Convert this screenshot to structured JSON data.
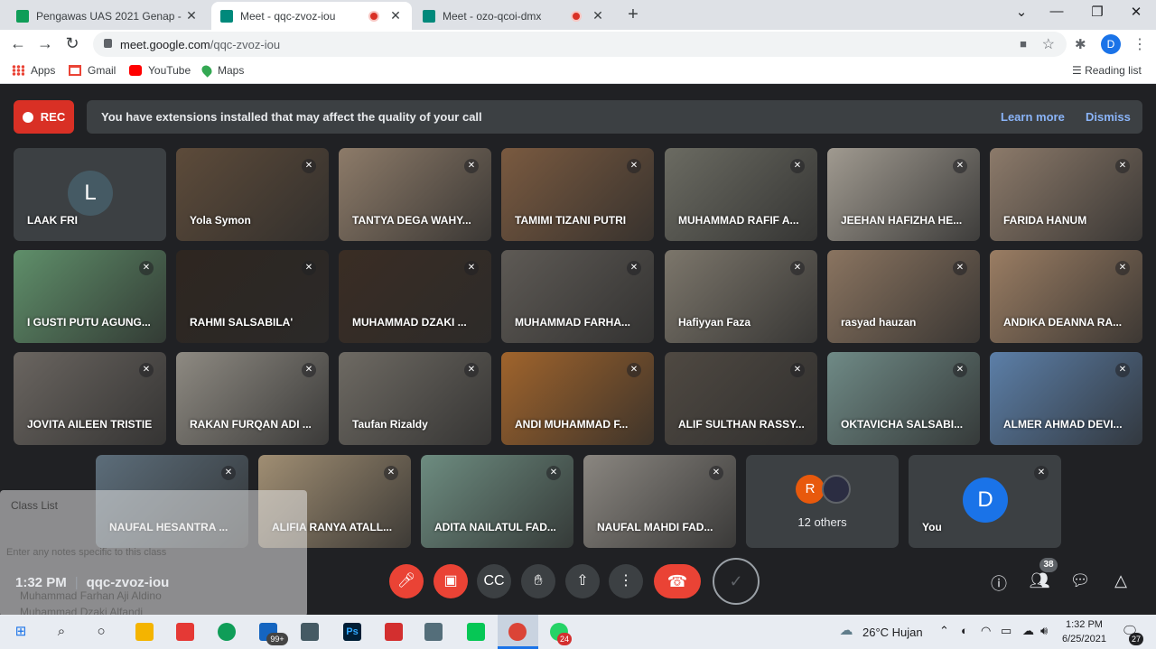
{
  "browser": {
    "tabs": [
      {
        "title": "Pengawas UAS 2021 Genap - Goo",
        "favicon_color": "#0f9d58"
      },
      {
        "title": "Meet - qqc-zvoz-iou",
        "favicon_color": "#00897b",
        "recording": true
      },
      {
        "title": "Meet - ozo-qcoi-dmx",
        "favicon_color": "#00897b",
        "recording": true
      }
    ],
    "url_host": "meet.google.com",
    "url_path": "/qqc-zvoz-iou",
    "profile_initial": "D",
    "bookmarks": [
      "Apps",
      "Gmail",
      "YouTube",
      "Maps"
    ],
    "reading_list": "Reading list"
  },
  "meet": {
    "rec_label": "REC",
    "banner_message": "You have extensions installed that may affect the quality of your call",
    "learn_more": "Learn more",
    "dismiss": "Dismiss",
    "participants": [
      {
        "name": "LAAK FRI",
        "avatar": "L",
        "avatar_color": "#455a64",
        "bg": "#3c4043",
        "muted": false
      },
      {
        "name": "Yola Symon",
        "bg": "#5d4b3a",
        "muted": true
      },
      {
        "name": "TANTYA DEGA WAHY...",
        "bg": "#8d7b69",
        "muted": true
      },
      {
        "name": "TAMIMI TIZANI PUTRI",
        "bg": "#7a5a40",
        "muted": true
      },
      {
        "name": "MUHAMMAD RAFIF A...",
        "bg": "#6b6b62",
        "muted": true
      },
      {
        "name": "JEEHAN HAFIZHA HE...",
        "bg": "#a09a90",
        "muted": true
      },
      {
        "name": "FARIDA HANUM",
        "bg": "#8c7a6a",
        "muted": true
      },
      {
        "name": "I GUSTI PUTU AGUNG...",
        "bg": "#5f8f6a",
        "muted": true
      },
      {
        "name": "RAHMI SALSABILA'",
        "bg": "#2e2620",
        "muted": true
      },
      {
        "name": "MUHAMMAD DZAKI ...",
        "bg": "#3a2d24",
        "muted": true
      },
      {
        "name": "MUHAMMAD FARHA...",
        "bg": "#5e5a55",
        "muted": true
      },
      {
        "name": "Hafiyyan Faza",
        "bg": "#7c766b",
        "muted": true
      },
      {
        "name": "rasyad hauzan",
        "bg": "#8a7460",
        "muted": true
      },
      {
        "name": "ANDIKA DEANNA RA...",
        "bg": "#9a7d63",
        "muted": true
      },
      {
        "name": "JOVITA AILEEN TRISTIE",
        "bg": "#6a6560",
        "muted": true
      },
      {
        "name": "RAKAN FURQAN ADI ...",
        "bg": "#8e8a82",
        "muted": true
      },
      {
        "name": "Taufan Rizaldy",
        "bg": "#6e6a63",
        "muted": true
      },
      {
        "name": "ANDI MUHAMMAD F...",
        "bg": "#a0642c",
        "muted": true
      },
      {
        "name": "ALIF SULTHAN RASSY...",
        "bg": "#4f4942",
        "muted": true
      },
      {
        "name": "OKTAVICHA SALSABI...",
        "bg": "#6f8a86",
        "muted": true
      },
      {
        "name": "ALMER AHMAD DEVI...",
        "bg": "#5c7fa8",
        "muted": true
      },
      {
        "name": "NAUFAL HESANTRA ...",
        "bg": "#5c6d7a",
        "muted": true
      },
      {
        "name": "ALIFIA RANYA ATALL...",
        "bg": "#a08e73",
        "muted": true
      },
      {
        "name": "ADITA NAILATUL FAD...",
        "bg": "#6d8c80",
        "muted": true
      },
      {
        "name": "NAUFAL MAHDI FAD...",
        "bg": "#8a8680",
        "muted": true
      }
    ],
    "others": {
      "label": "12 others",
      "avatar": "R",
      "avatar_color": "#e8590c"
    },
    "self": {
      "label": "You",
      "avatar": "D",
      "avatar_color": "#1a73e8"
    },
    "time": "1:32 PM",
    "meeting_code": "qqc-zvoz-iou",
    "participant_count": "38"
  },
  "overlay": {
    "title": "Class List",
    "notes_placeholder": "Enter any notes specific to this class",
    "rows": [
      "Muhammad Farhan Aji Aldino",
      "Muhammad Dzaki Alfandi"
    ]
  },
  "taskbar": {
    "store_badge": "99+",
    "whatsapp_badge": "24",
    "weather": "26°C  Hujan",
    "clock_time": "1:32 PM",
    "clock_date": "6/25/2021",
    "notification_count": "27"
  }
}
